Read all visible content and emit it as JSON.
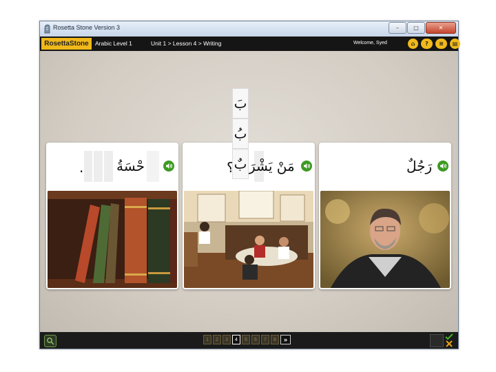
{
  "window": {
    "title": "Rosetta Stone Version 3",
    "controls": [
      "–",
      "□",
      "✕"
    ]
  },
  "appbar": {
    "logo": "RosettaStone",
    "course": "Arabic Level 1",
    "breadcrumb": "Unit 1 > Lesson 4 > Writing",
    "welcome": "Welcome, Syed",
    "icons": [
      {
        "name": "home-icon",
        "glyph": "⌂"
      },
      {
        "name": "help-icon",
        "glyph": "?"
      },
      {
        "name": "menu-icon",
        "glyph": "≡"
      },
      {
        "name": "chat-icon",
        "glyph": "▤"
      }
    ]
  },
  "tiles": [
    "بَ",
    "بُ",
    "بٌ"
  ],
  "cards": {
    "left": {
      "text": "حْسَةُ",
      "period": ".",
      "image": "books"
    },
    "middle": {
      "text_before": "مَنْ يَشْرَ",
      "text_after": "؟",
      "image": "restaurant"
    },
    "right": {
      "text": "رَجُلٌ",
      "image": "man"
    }
  },
  "pager": {
    "pages": [
      "1",
      "2",
      "3",
      "4",
      "5",
      "6",
      "7",
      "8"
    ],
    "current": 4,
    "next": "»"
  },
  "colors": {
    "accent": "#f0b81a",
    "speaker": "#3c9a22",
    "bar": "#151515"
  }
}
